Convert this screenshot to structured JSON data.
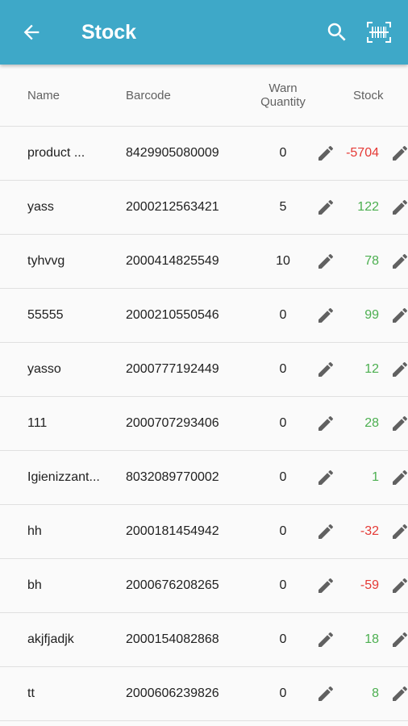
{
  "appbar": {
    "title": "Stock",
    "back_icon": "arrow-back-icon",
    "search_icon": "search-icon",
    "scan_icon": "barcode-scan-icon",
    "color": "#3ea8c8"
  },
  "columns": {
    "name": "Name",
    "barcode": "Barcode",
    "warn": "Warn Quantity",
    "stock": "Stock"
  },
  "rows": [
    {
      "name": "product ...",
      "barcode": "8429905080009",
      "warn": "0",
      "stock": "-5704",
      "status": "neg"
    },
    {
      "name": "yass",
      "barcode": "2000212563421",
      "warn": "5",
      "stock": "122",
      "status": "pos"
    },
    {
      "name": "tyhvvg",
      "barcode": "2000414825549",
      "warn": "10",
      "stock": "78",
      "status": "pos"
    },
    {
      "name": "55555",
      "barcode": "2000210550546",
      "warn": "0",
      "stock": "99",
      "status": "pos"
    },
    {
      "name": "yasso",
      "barcode": "2000777192449",
      "warn": "0",
      "stock": "12",
      "status": "pos"
    },
    {
      "name": "111",
      "barcode": "2000707293406",
      "warn": "0",
      "stock": "28",
      "status": "pos"
    },
    {
      "name": "Igienizzant...",
      "barcode": "8032089770002",
      "warn": "0",
      "stock": "1",
      "status": "pos"
    },
    {
      "name": "hh",
      "barcode": "2000181454942",
      "warn": "0",
      "stock": "-32",
      "status": "neg"
    },
    {
      "name": "bh",
      "barcode": "2000676208265",
      "warn": "0",
      "stock": "-59",
      "status": "neg"
    },
    {
      "name": "akjfjadjk",
      "barcode": "2000154082868",
      "warn": "0",
      "stock": "18",
      "status": "pos"
    },
    {
      "name": "tt",
      "barcode": "2000606239826",
      "warn": "0",
      "stock": "8",
      "status": "pos"
    }
  ],
  "colors": {
    "positive": "#4caf50",
    "negative": "#e53935"
  }
}
